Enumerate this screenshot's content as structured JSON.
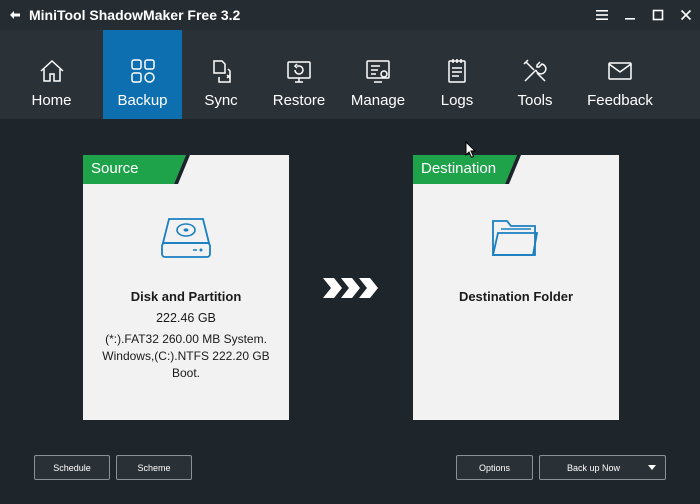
{
  "window": {
    "title": "MiniTool ShadowMaker Free 3.2"
  },
  "nav": {
    "items": [
      {
        "label": "Home",
        "icon": "home-icon"
      },
      {
        "label": "Backup",
        "icon": "backup-icon",
        "active": true
      },
      {
        "label": "Sync",
        "icon": "sync-icon"
      },
      {
        "label": "Restore",
        "icon": "restore-icon"
      },
      {
        "label": "Manage",
        "icon": "manage-icon"
      },
      {
        "label": "Logs",
        "icon": "logs-icon"
      },
      {
        "label": "Tools",
        "icon": "tools-icon"
      },
      {
        "label": "Feedback",
        "icon": "feedback-icon"
      }
    ]
  },
  "source": {
    "header": "Source",
    "title": "Disk and Partition",
    "size": "222.46 GB",
    "description": "(*:).FAT32 260.00 MB System. Windows,(C:).NTFS 222.20 GB Boot."
  },
  "destination": {
    "header": "Destination",
    "title": "Destination Folder"
  },
  "buttons": {
    "schedule": "Schedule",
    "scheme": "Scheme",
    "options": "Options",
    "backup_now": "Back up Now"
  },
  "colors": {
    "accent_blue": "#0e6fb0",
    "header_green": "#1fa34a",
    "icon_blue": "#1a7fc1"
  }
}
